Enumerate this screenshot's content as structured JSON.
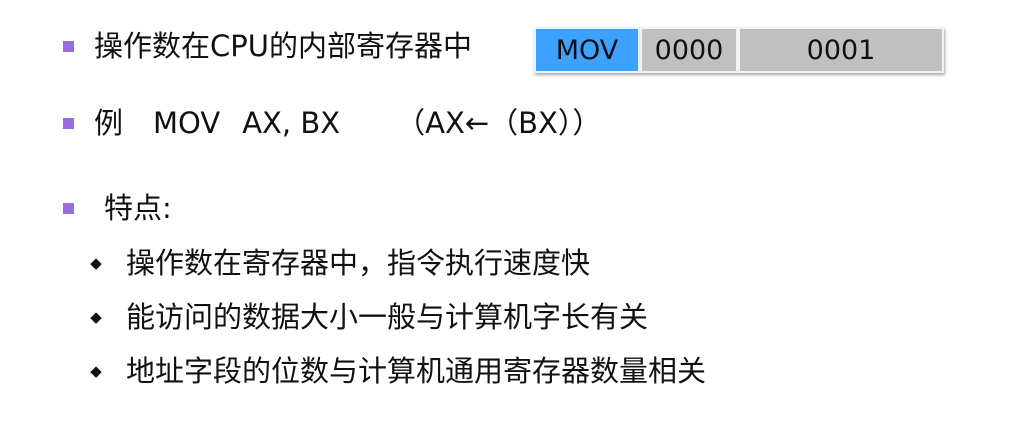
{
  "line1": "操作数在CPU的内部寄存器中",
  "instruction": {
    "opcode": "MOV",
    "field1": "0000",
    "field2": "0001"
  },
  "example": {
    "label": "例",
    "instr": "MOV",
    "operands": "AX, BX",
    "note": "（AX←（BX））"
  },
  "features": {
    "title": "特点:",
    "items": [
      "操作数在寄存器中，指令执行速度快",
      "能访问的数据大小一般与计算机字长有关",
      "地址字段的位数与计算机通用寄存器数量相关"
    ]
  },
  "colors": {
    "bullet": "#9b6be0",
    "opcode_bg": "#3da1ff",
    "field_bg": "#c0c0c0"
  }
}
